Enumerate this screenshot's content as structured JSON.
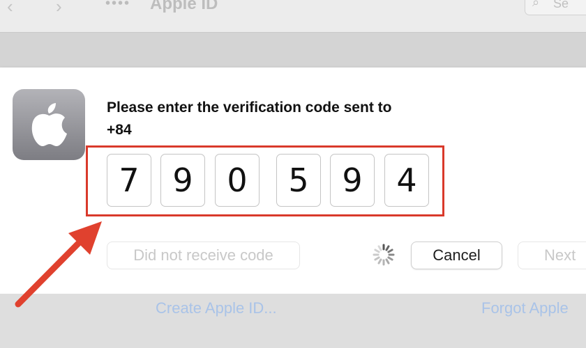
{
  "window": {
    "title": "Apple ID",
    "nav_back_glyph": "‹",
    "nav_forward_glyph": "›",
    "grid_icon": "grid-icon",
    "search_glyph": "⌕",
    "search_placeholder": "Se"
  },
  "dialog": {
    "app_icon": "apple-logo-icon",
    "prompt_line1": "Please enter the verification code sent to",
    "prompt_line2": "+84",
    "code_digits": [
      "7",
      "9",
      "0",
      "5",
      "9",
      "4"
    ],
    "resend_label": "Did not receive code",
    "cancel_label": "Cancel",
    "next_label": "Next",
    "spinner_icon": "loading-spinner-icon"
  },
  "footer": {
    "create_link": "Create Apple ID...",
    "forgot_link": "Forgot Apple"
  },
  "annotation": {
    "highlight_color": "#d9392b",
    "arrow_icon": "red-arrow-icon"
  }
}
